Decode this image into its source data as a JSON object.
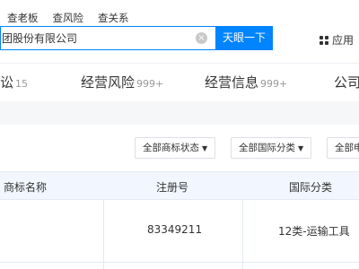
{
  "search": {
    "tabs": [
      "查老板",
      "查风险",
      "查关系"
    ],
    "value": "团股份有限公司",
    "clear_icon": "×",
    "button_label": "天眼一下"
  },
  "apps": {
    "label": "应用",
    "icon": "grid-icon"
  },
  "nav": [
    {
      "label": "讼",
      "count": "15"
    },
    {
      "label": "经营风险",
      "count": "999+"
    },
    {
      "label": "经营信息",
      "count": "999+"
    },
    {
      "label": "公司",
      "count": ""
    }
  ],
  "filters": [
    {
      "label": "全部商标状态",
      "caret": "▼"
    },
    {
      "label": "全部国际分类",
      "caret": "▼"
    },
    {
      "label": "全部申",
      "caret": ""
    }
  ],
  "table": {
    "headers": [
      "商标名称",
      "注册号",
      "国际分类"
    ],
    "rows": [
      {
        "name": "",
        "reg_no": "83349211",
        "category": "12类-运输工具"
      }
    ]
  },
  "colors": {
    "accent": "#0084ff",
    "header_bg": "#f2f7ff",
    "gap_bg": "#f6f7f9"
  }
}
